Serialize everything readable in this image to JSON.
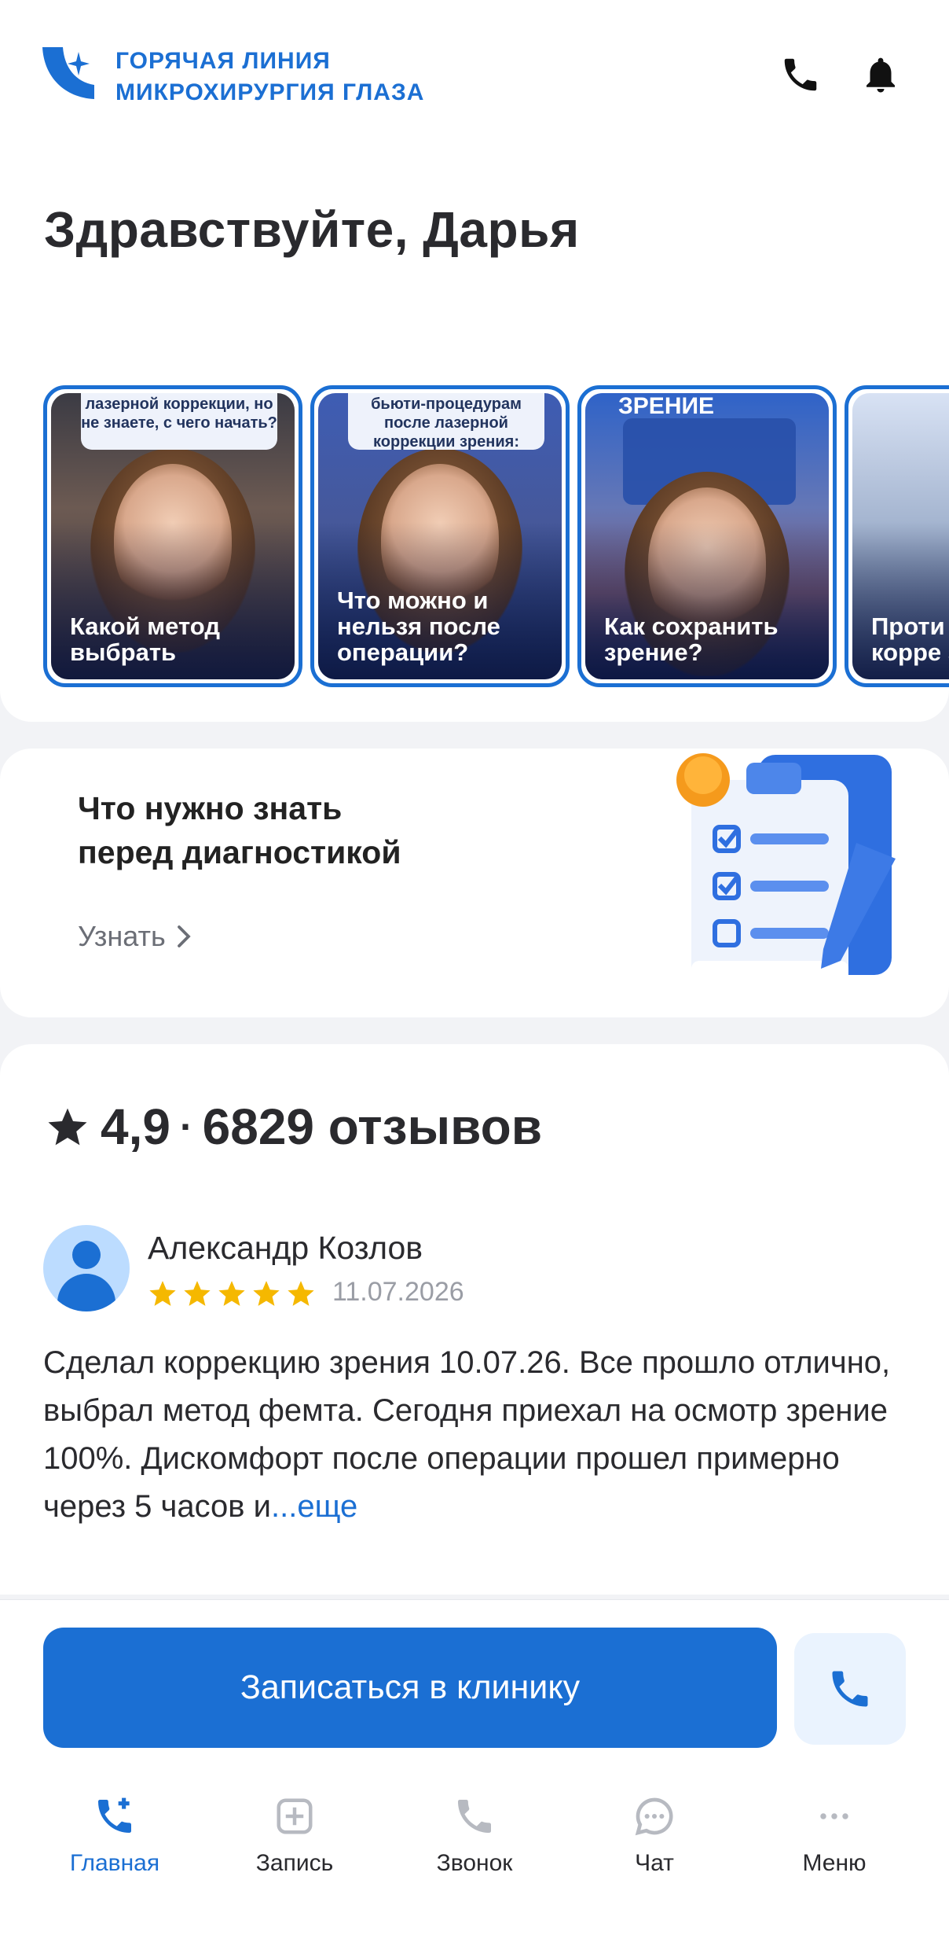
{
  "header": {
    "brand_line1": "ГОРЯЧАЯ ЛИНИЯ",
    "brand_line2": "МИКРОХИРУРГИЯ ГЛАЗА",
    "icons": [
      "phone-icon",
      "bell-icon"
    ]
  },
  "greeting": "Здравствуйте, Дарья",
  "stories": [
    {
      "bubble": "лазерной коррекции, но не знаете, с чего начать?",
      "title": "Какой метод выбрать"
    },
    {
      "bubble": "бьюти-процедурам после лазерной коррекции зрения:",
      "title": "Что можно и нельзя после операции?"
    },
    {
      "tag": "ЗРЕНИЕ",
      "title": "Как сохранить зрение?"
    },
    {
      "title": "Проти к лазе корре зрени"
    }
  ],
  "info_card": {
    "title_line1": "Что нужно знать",
    "title_line2": "перед диагностикой",
    "link": "Узнать"
  },
  "reviews": {
    "rating": "4,9",
    "separator": "·",
    "count": "6829 отзывов",
    "review": {
      "name": "Александр Козлов",
      "stars": 5,
      "date": "11.07.2026",
      "text": "Сделал коррекцию зрения 10.07.26. Все прошло отлично, выбрал метод фемта. Сегодня приехал на осмотр зрение 100%. Дискомфорт после операции прошел примерно через 5 часов и",
      "more": "...еще"
    }
  },
  "cta": {
    "label": "Записаться в клинику"
  },
  "tabs": [
    {
      "label": "Главная",
      "icon": "phone-plus-icon",
      "active": true
    },
    {
      "label": "Запись",
      "icon": "plus-square-icon"
    },
    {
      "label": "Звонок",
      "icon": "phone-icon"
    },
    {
      "label": "Чат",
      "icon": "chat-icon"
    },
    {
      "label": "Меню",
      "icon": "more-icon"
    }
  ],
  "colors": {
    "accent": "#1b6fd3",
    "star": "#f5b800",
    "background": "#f2f3f6"
  }
}
